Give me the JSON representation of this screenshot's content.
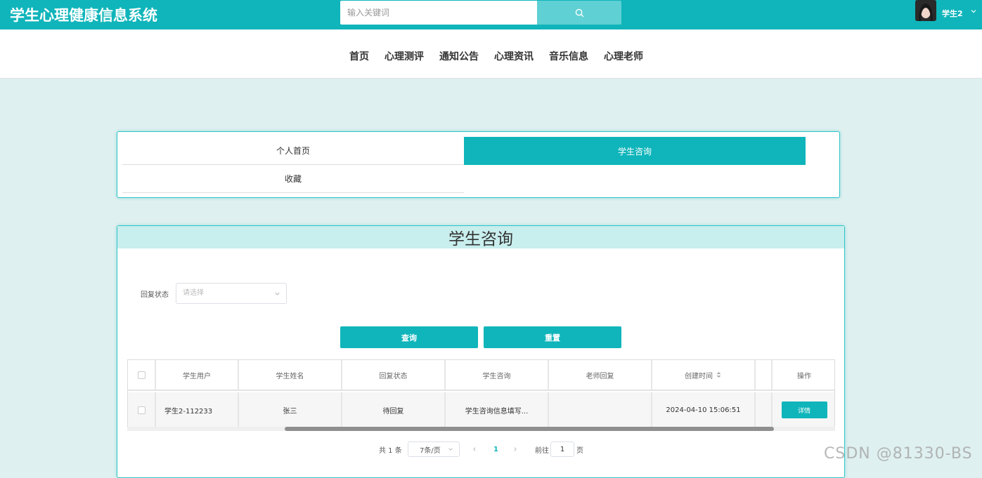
{
  "header": {
    "site_title": "学生心理健康信息系统",
    "search_placeholder": "输入关键词",
    "user_name": "学生2"
  },
  "nav": {
    "items": [
      "首页",
      "心理测评",
      "通知公告",
      "心理资讯",
      "音乐信息",
      "心理老师"
    ]
  },
  "tabs": {
    "home": "个人首页",
    "consult": "学生咨询",
    "favorites": "收藏"
  },
  "main": {
    "title": "学生咨询",
    "filter_label": "回复状态",
    "select_placeholder": "请选择",
    "query_button": "查询",
    "reset_button": "重置"
  },
  "table": {
    "columns": [
      "学生用户",
      "学生姓名",
      "回复状态",
      "学生咨询",
      "老师回复",
      "创建时间",
      "操作"
    ],
    "rows": [
      {
        "user": "学生2-112233",
        "name": "张三",
        "status": "待回复",
        "consult": "学生咨询信息填写...",
        "reply": "",
        "created": "2024-04-10 15:06:51",
        "action": "详情"
      }
    ]
  },
  "pagination": {
    "total": "共 1 条",
    "page_size": "7条/页",
    "current_page": "1",
    "goto_label": "前往",
    "goto_value": "1",
    "page_suffix": "页"
  },
  "watermark": "CSDN @81330-BS",
  "colors": {
    "brand": "#0fb5ba",
    "background": "#def0ef"
  }
}
